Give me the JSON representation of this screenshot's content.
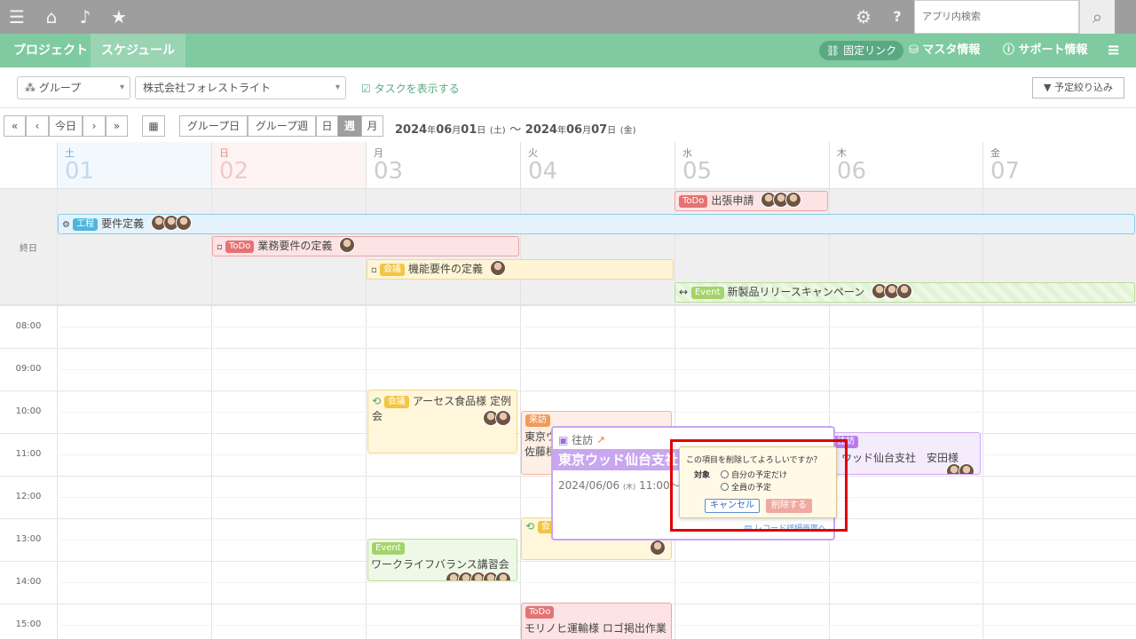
{
  "topbar": {
    "menu_icon": "hamburger-icon",
    "home_icon": "home-icon",
    "bell_icon": "bell-icon",
    "star_icon": "star-icon",
    "gear_icon": "gear-icon",
    "help_icon": "help-icon",
    "search_placeholder": "アプリ内検索",
    "search_icon": "search-icon"
  },
  "nav": {
    "tabs": [
      {
        "label": "プロジェクト"
      },
      {
        "label": "スケジュール",
        "active": true
      }
    ],
    "fixed_link": "固定リンク",
    "master": "マスタ情報",
    "support": "サポート情報"
  },
  "filters": {
    "group": "グループ",
    "company": "株式会社フォレストライト",
    "show_tasks": "タスクを表示する",
    "narrow": "予定絞り込み"
  },
  "datebar": {
    "nav": [
      "«",
      "‹",
      "今日",
      "›",
      "»"
    ],
    "views": [
      "グループ日",
      "グループ週",
      "日",
      "週",
      "月"
    ],
    "active_view": "週",
    "range_start": "2024",
    "range_start_mid": "年",
    "range_start_m": "06",
    "range_start_m2": "月",
    "range_start_d": "01",
    "range_start_d2": "日",
    "range_start_wd": "(土)",
    "range_sep": "〜",
    "range_end": "2024",
    "range_end_m": "06",
    "range_end_d": "07",
    "range_end_wd": "(金)"
  },
  "days": [
    {
      "wd": "土",
      "dn": "01"
    },
    {
      "wd": "日",
      "dn": "02"
    },
    {
      "wd": "月",
      "dn": "03"
    },
    {
      "wd": "火",
      "dn": "04"
    },
    {
      "wd": "水",
      "dn": "05"
    },
    {
      "wd": "木",
      "dn": "06"
    },
    {
      "wd": "金",
      "dn": "07"
    }
  ],
  "allday_label": "終日",
  "allday_events": [
    {
      "tag": "ToDo",
      "title": "出張申請"
    },
    {
      "tag": "工程",
      "title": "要件定義"
    },
    {
      "tag": "ToDo",
      "title": "業務要件の定義"
    },
    {
      "tag": "会議",
      "title": "機能要件の定義"
    },
    {
      "tag": "Event",
      "title": "新製品リリースキャンペーン"
    }
  ],
  "hours": [
    "08:00",
    "09:00",
    "10:00",
    "11:00",
    "12:00",
    "13:00",
    "14:00",
    "15:00"
  ],
  "events": {
    "asesu": {
      "tag": "会議",
      "title": "アーセス食品様 定例会"
    },
    "visit1": {
      "tag": "来訪",
      "l1": "東京ウ",
      "l2": "佐藤様"
    },
    "thu": {
      "tag": "往訪",
      "title": "ウッド仙台支社　安田様"
    },
    "wlb": {
      "tag": "Event",
      "title": "ワークライフバランス講習会"
    },
    "tue13": {
      "tag": "会"
    },
    "todo15": {
      "tag": "ToDo",
      "title": "モリノヒ運輸様 ロゴ掲出作業"
    }
  },
  "popup": {
    "type": "往訪",
    "title": "東京ウッド仙台支社",
    "date": "2024/06/06",
    "wd": "(木)",
    "time": "11:00～202",
    "link": "レコード詳細画面へ"
  },
  "confirm": {
    "question": "この項目を削除してよろしいですか？",
    "target": "対象",
    "opt1": "自分の予定だけ",
    "opt2": "全員の予定",
    "cancel": "キャンセル",
    "delete": "削除する"
  }
}
